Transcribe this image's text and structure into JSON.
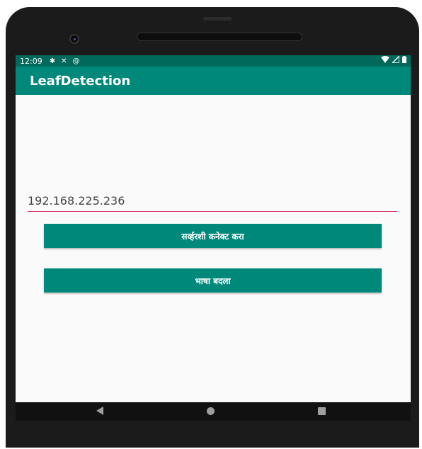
{
  "status_bar": {
    "time": "12:09",
    "icons": [
      "gear-icon",
      "tools-icon",
      "at-icon"
    ],
    "right_icons": [
      "wifi-icon",
      "signal-icon",
      "battery-icon"
    ]
  },
  "app_bar": {
    "title": "LeafDetection"
  },
  "main": {
    "ip_input_value": "192.168.225.236",
    "connect_button_label": "सर्व्हरशी कनेक्ट करा",
    "language_button_label": "भाषा बदला"
  },
  "nav_bar": {
    "icons": [
      "back-icon",
      "home-icon",
      "recents-icon"
    ]
  },
  "colors": {
    "status_bar": "#00695c",
    "app_bar": "#00897b",
    "button": "#00897b",
    "input_underline": "#d81b60"
  }
}
